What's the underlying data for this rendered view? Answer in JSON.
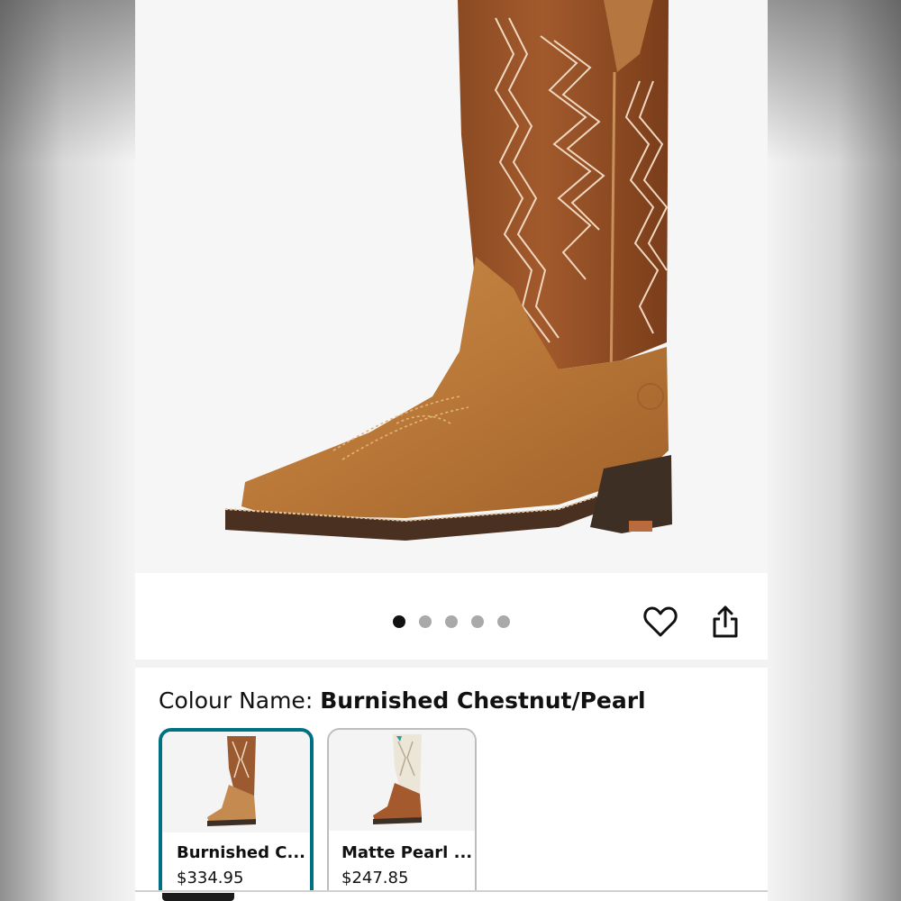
{
  "gallery": {
    "image_icon": "cowboy-boot-product-image",
    "pagination": {
      "total": 5,
      "active_index": 0
    },
    "wishlist_icon": "heart-icon",
    "share_icon": "share-icon"
  },
  "colour": {
    "label": "Colour Name: ",
    "selected_name": "Burnished Chestnut/Pearl",
    "options": [
      {
        "name": "Burnished C...",
        "price": "$334.95",
        "selected": true
      },
      {
        "name": "Matte Pearl ...",
        "price": "$247.85",
        "selected": false
      }
    ]
  },
  "colors": {
    "selected_border": "#007185",
    "active_dot": "#111111",
    "inactive_dot": "#a9a9a9"
  }
}
